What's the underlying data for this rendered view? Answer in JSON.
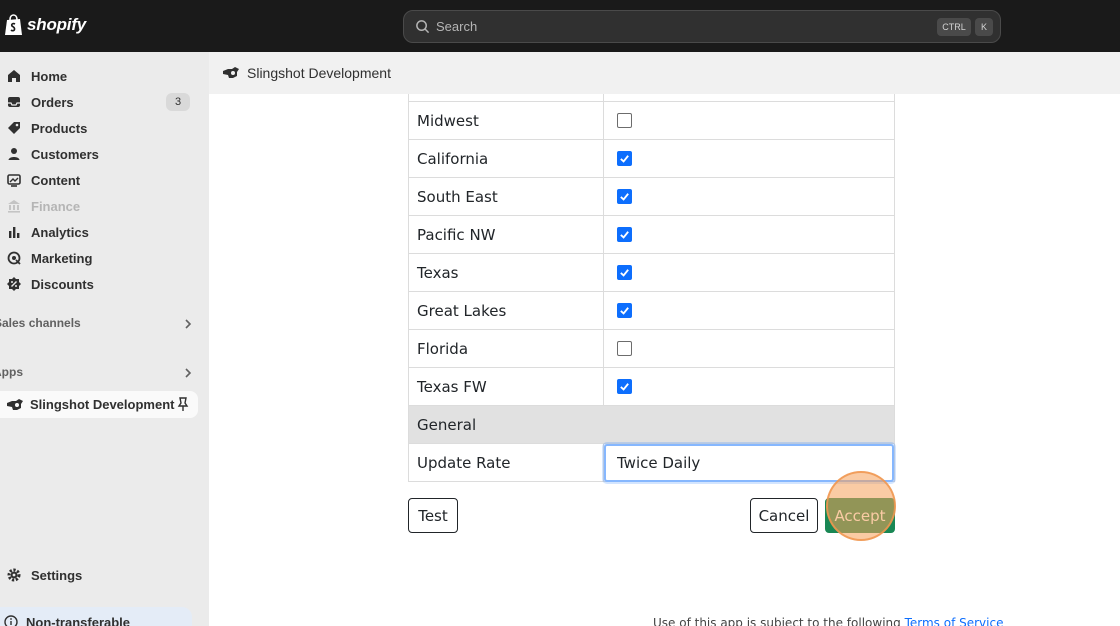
{
  "topbar": {
    "logo_text": "shopify",
    "search_placeholder": "Search",
    "shortcut_ctrl": "CTRL",
    "shortcut_k": "K"
  },
  "sidebar": {
    "items": [
      {
        "label": "Home",
        "icon": "home-icon"
      },
      {
        "label": "Orders",
        "icon": "orders-icon",
        "badge": "3"
      },
      {
        "label": "Products",
        "icon": "tag-icon"
      },
      {
        "label": "Customers",
        "icon": "person-icon"
      },
      {
        "label": "Content",
        "icon": "content-icon"
      },
      {
        "label": "Finance",
        "icon": "bank-icon",
        "disabled": true
      },
      {
        "label": "Analytics",
        "icon": "bar-chart-icon"
      },
      {
        "label": "Marketing",
        "icon": "target-icon"
      },
      {
        "label": "Discounts",
        "icon": "discount-icon"
      }
    ],
    "sales_channels_label": "Sales channels",
    "apps_label": "Apps",
    "active_app_label": "Slingshot Development",
    "settings_label": "Settings",
    "non_transferable_label": "Non-transferable"
  },
  "appbar": {
    "title": "Slingshot Development"
  },
  "regions": [
    {
      "name": "Midwest",
      "checked": false
    },
    {
      "name": "California",
      "checked": true
    },
    {
      "name": "South East",
      "checked": true
    },
    {
      "name": "Pacific NW",
      "checked": true
    },
    {
      "name": "Texas",
      "checked": true
    },
    {
      "name": "Great Lakes",
      "checked": true
    },
    {
      "name": "Florida",
      "checked": false
    },
    {
      "name": "Texas FW",
      "checked": true
    }
  ],
  "general": {
    "section_label": "General",
    "update_rate_label": "Update Rate",
    "update_rate_value": "Twice Daily"
  },
  "actions": {
    "test_label": "Test",
    "cancel_label": "Cancel",
    "accept_label": "Accept"
  },
  "footer": {
    "tos_text": "Use of this app is subject to the following",
    "tos_link": "Terms of Service"
  },
  "colors": {
    "accept_green": "#198754",
    "checkbox_blue": "#0d6efd",
    "topbar_bg": "#1a1a1a"
  }
}
